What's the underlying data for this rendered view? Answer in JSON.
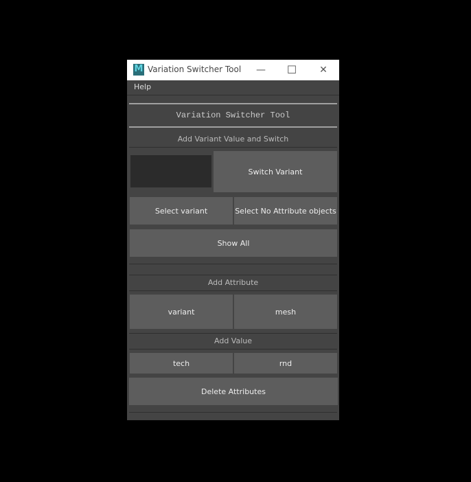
{
  "window": {
    "title": "Variation Switcher Tool",
    "minimize": "—",
    "maximize": "☐",
    "close": "✕",
    "logo": "M"
  },
  "menu": {
    "help": "Help"
  },
  "header": "Variation Switcher Tool",
  "section1": {
    "label": "Add Variant Value and Switch",
    "input_value": "",
    "switch": "Switch Variant",
    "select_variant": "Select variant",
    "select_no_attr": "Select No Attribute objects",
    "show_all": "Show All"
  },
  "section2": {
    "label": "Add Attribute",
    "variant": "variant",
    "mesh": "mesh"
  },
  "section3": {
    "label": "Add Value",
    "tech": "tech",
    "rnd": "rnd",
    "delete": "Delete Attributes"
  }
}
